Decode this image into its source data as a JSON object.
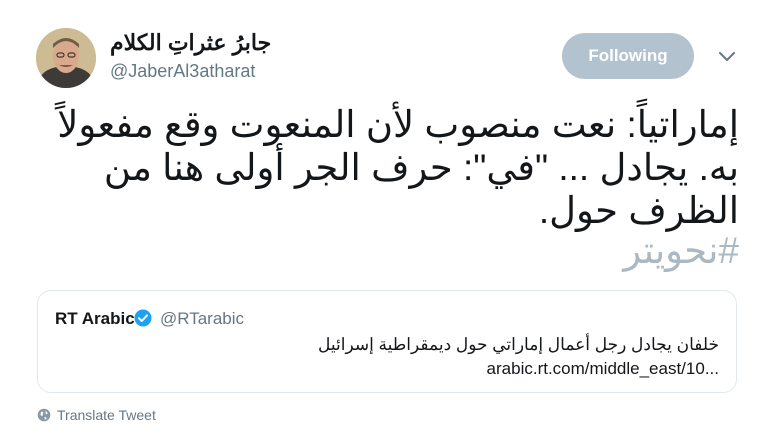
{
  "author": {
    "display_name": "جابرُ عثراتِ الكلام",
    "handle": "@JaberAl3atharat"
  },
  "follow_button": {
    "label": "Following"
  },
  "tweet": {
    "text": "إماراتياً: نعت منصوب لأن المنعوت وقع مفعولاً به. يجادل ... \"في\": حرف الجر أولى هنا من الظرف حول.",
    "hashtag": "#نحويتر"
  },
  "quoted_tweet": {
    "display_name": "RT Arabic",
    "handle": "@RTarabic",
    "text": "خلفان يجادل رجل أعمال إماراتي حول ديمقراطية إسرائيل",
    "link": "arabic.rt.com/middle_east/10..."
  },
  "translate": {
    "label": "Translate Tweet"
  },
  "icons": {
    "caret": "chevron-down-icon",
    "verified": "verified-badge-icon",
    "globe": "globe-icon"
  },
  "colors": {
    "following_button_bg": "#b2c2cf",
    "hashtag": "#aab8c2",
    "verified": "#1da1f2",
    "secondary_text": "#657786"
  }
}
